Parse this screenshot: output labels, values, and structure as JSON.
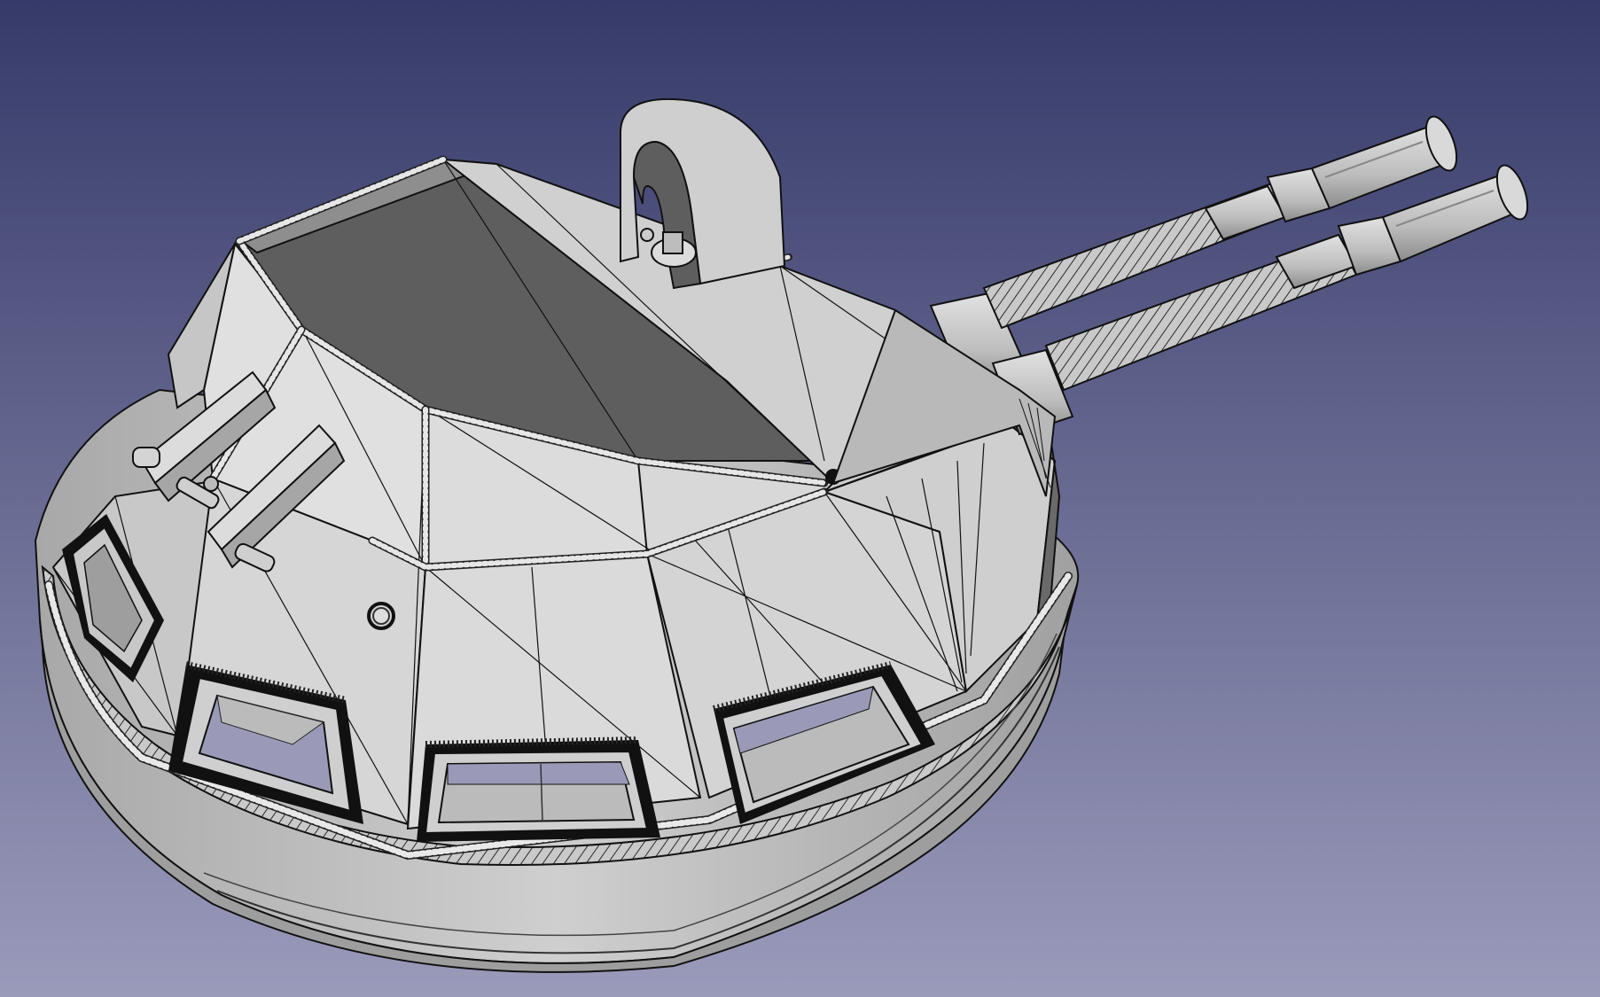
{
  "viewport": {
    "background_top": "#363a69",
    "background_bottom": "#9a9bbb"
  },
  "model": {
    "object": "twin-barrel-turret",
    "render_mode": "flat-lines",
    "face_color": "#d2d2d2",
    "shadow_color": "#8a8a8a",
    "dark_face_color": "#5e5e5e",
    "edge_color": "#111111"
  }
}
